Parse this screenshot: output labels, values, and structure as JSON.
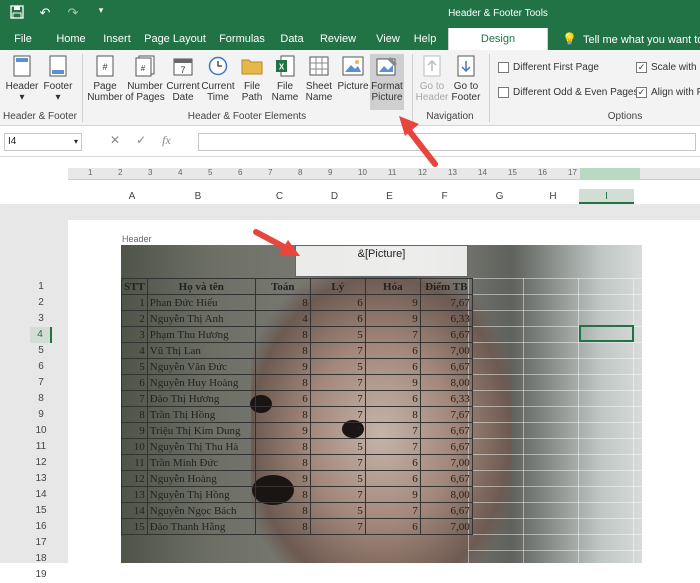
{
  "qat": {
    "icons": [
      "save-icon",
      "undo-icon",
      "redo-icon",
      "customize-qat-icon"
    ]
  },
  "contextual_tab_group": "Header & Footer Tools",
  "tabs": [
    "File",
    "Home",
    "Insert",
    "Page Layout",
    "Formulas",
    "Data",
    "Review",
    "View",
    "Help",
    "Design"
  ],
  "active_tab": "Design",
  "tell_me": "Tell me what you want to do",
  "ribbon": {
    "header_footer": {
      "header": "Header",
      "footer": "Footer",
      "group": "Header & Footer"
    },
    "elements": {
      "page_number": [
        "Page",
        "Number"
      ],
      "number_of_pages": [
        "Number",
        "of Pages"
      ],
      "current_date": [
        "Current",
        "Date"
      ],
      "current_time": [
        "Current",
        "Time"
      ],
      "file_path": [
        "File",
        "Path"
      ],
      "file_name": [
        "File",
        "Name"
      ],
      "sheet_name": [
        "Sheet",
        "Name"
      ],
      "picture": "Picture",
      "format_picture": [
        "Format",
        "Picture"
      ],
      "group": "Header & Footer Elements"
    },
    "navigation": {
      "go_to_header": [
        "Go to",
        "Header"
      ],
      "go_to_footer": [
        "Go to",
        "Footer"
      ],
      "group": "Navigation"
    },
    "options": {
      "different_first_page": "Different First Page",
      "different_odd_even": "Different Odd & Even Pages",
      "scale_with_doc": "Scale with D",
      "align_with_margins": "Align with P",
      "group": "Options"
    }
  },
  "formula_bar": {
    "name_box": "I4",
    "cancel": "✕",
    "enter": "✓",
    "fx": "fx"
  },
  "ruler_numbers": [
    "1",
    "2",
    "3",
    "4",
    "5",
    "6",
    "7",
    "8",
    "9",
    "10",
    "11",
    "12",
    "13",
    "14",
    "15",
    "16",
    "17"
  ],
  "columns": [
    "A",
    "B",
    "C",
    "D",
    "E",
    "F",
    "G",
    "H",
    "I"
  ],
  "selected_column": "I",
  "header_label": "Header",
  "header_picture_field": "&[Picture]",
  "row_numbers": [
    "1",
    "2",
    "3",
    "4",
    "5",
    "6",
    "7",
    "8",
    "9",
    "10",
    "11",
    "12",
    "13",
    "14",
    "15",
    "16",
    "17",
    "18",
    "19"
  ],
  "selected_row": "4",
  "table": {
    "headers": [
      "STT",
      "Họ và tên",
      "Toán",
      "Lý",
      "Hóa",
      "Điểm TB"
    ],
    "rows": [
      [
        "1",
        "Phan Đức Hiếu",
        "8",
        "6",
        "9",
        "7,67"
      ],
      [
        "2",
        "Nguyễn Thị Anh",
        "4",
        "6",
        "9",
        "6,33"
      ],
      [
        "3",
        "Phạm Thu Hương",
        "8",
        "5",
        "7",
        "6,67"
      ],
      [
        "4",
        "Vũ Thị Lan",
        "8",
        "7",
        "6",
        "7,00"
      ],
      [
        "5",
        "Nguyễn Văn Đức",
        "9",
        "5",
        "6",
        "6,67"
      ],
      [
        "6",
        "Nguyễn Huy Hoàng",
        "8",
        "7",
        "9",
        "8,00"
      ],
      [
        "7",
        "Đào Thị Hương",
        "6",
        "7",
        "6",
        "6,33"
      ],
      [
        "8",
        "Trần Thị Hồng",
        "8",
        "7",
        "8",
        "7,67"
      ],
      [
        "9",
        "Triệu Thị Kim Dung",
        "9",
        "5",
        "7",
        "6,67"
      ],
      [
        "10",
        "Nguyễn Thị Thu Hà",
        "8",
        "5",
        "7",
        "6,67"
      ],
      [
        "11",
        "Trần Minh Đức",
        "8",
        "7",
        "6",
        "7,00"
      ],
      [
        "12",
        "Nguyễn Hoàng",
        "9",
        "5",
        "6",
        "6,67"
      ],
      [
        "13",
        "Nguyễn Thị Hồng",
        "8",
        "7",
        "9",
        "8,00"
      ],
      [
        "14",
        "Nguyễn Ngọc Bách",
        "8",
        "5",
        "7",
        "6,67"
      ],
      [
        "15",
        "Đào Thanh Hằng",
        "8",
        "7",
        "6",
        "7,00"
      ]
    ]
  },
  "colors": {
    "excel_green": "#217346",
    "arrow_red": "#e8453c"
  }
}
